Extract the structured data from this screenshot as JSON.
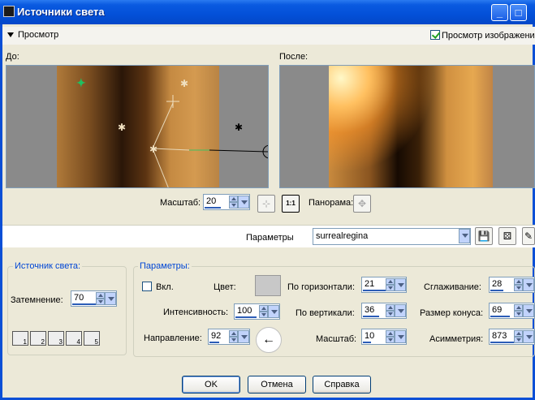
{
  "window": {
    "title": "Источники света"
  },
  "preview": {
    "toggle_label": "Просмотр",
    "show_image_label": "Просмотр изображения",
    "before_label": "До:",
    "after_label": "После:"
  },
  "zoom": {
    "label": "Масштаб:",
    "value": "20",
    "pan_label": "Панорама:",
    "one_to_one": "1:1"
  },
  "presets": {
    "label": "Параметры",
    "value": "surrealregina"
  },
  "light_source": {
    "group_title": "Источник света:",
    "dimming_label": "Затемнение:",
    "dimming_value": "70",
    "buttons": [
      "1",
      "2",
      "3",
      "4",
      "5"
    ]
  },
  "params": {
    "group_title": "Параметры:",
    "on_label": "Вкл.",
    "color_label": "Цвет:",
    "intensity_label": "Интенсивность:",
    "intensity_value": "100",
    "direction_label": "Направление:",
    "direction_value": "92",
    "horizontal_label": "По горизонтали:",
    "horizontal_value": "21",
    "vertical_label": "По вертикали:",
    "vertical_value": "36",
    "scale_label": "Масштаб:",
    "scale_value": "10",
    "smoothing_label": "Сглаживание:",
    "smoothing_value": "28",
    "cone_label": "Размер конуса:",
    "cone_value": "69",
    "asymmetry_label": "Асимметрия:",
    "asymmetry_value": "873"
  },
  "buttons": {
    "ok": "OK",
    "cancel": "Отмена",
    "help": "Справка"
  },
  "colors": {
    "titlebar": "#0350d8",
    "accent": "#2c5db7"
  }
}
